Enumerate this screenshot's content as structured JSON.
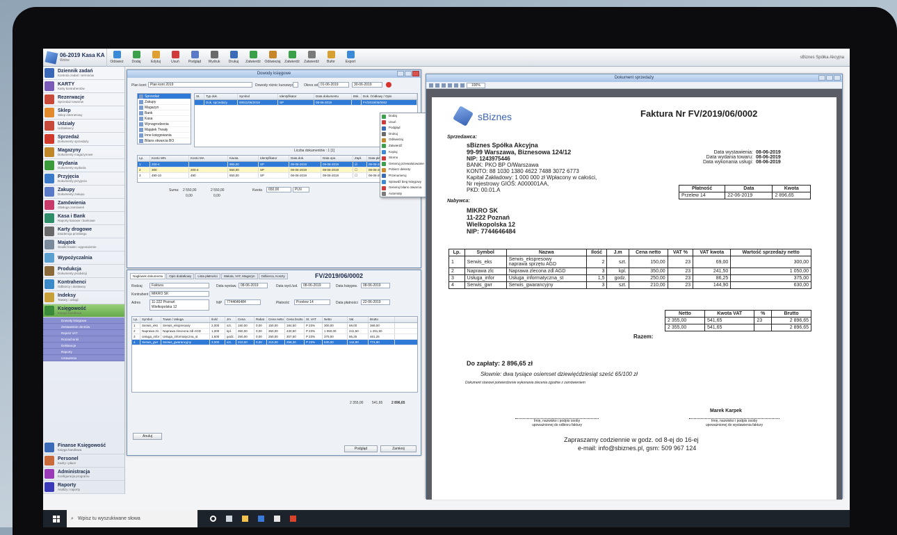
{
  "app": {
    "period": "06-2019 Kasa KA",
    "period_sub": "Wolne",
    "company": "sBiznes Spółka Akcyjna"
  },
  "toolbar": [
    "Odśwież",
    "Dodaj",
    "Edytuj",
    "Usuń",
    "Podgląd",
    "Wydruk",
    "Drukuj",
    "Zatwierdź",
    "Odświeżaj",
    "Zatwierdź",
    "Zatwierdź",
    "Bufor",
    "Export"
  ],
  "sidebar": [
    {
      "title": "Dziennik zadań",
      "sub": "Kontrola zadań i terminów",
      "color": "#3b67b8"
    },
    {
      "title": "KARTY",
      "sub": "Karty kontrahentów",
      "color": "#7a5bb8"
    },
    {
      "title": "Rezerwacje",
      "sub": "Sprzedaż towarów",
      "color": "#c84a3a"
    },
    {
      "title": "Sklep",
      "sub": "Sklep internetowy",
      "color": "#e08a2c"
    },
    {
      "title": "Udziały",
      "sub": "Udziałowcy",
      "color": "#c84a3a"
    },
    {
      "title": "Sprzedaż",
      "sub": "Dokumenty sprzedaży",
      "color": "#d0392e"
    },
    {
      "title": "Magazyny",
      "sub": "Dokumenty magazynowe",
      "color": "#c0862a"
    },
    {
      "title": "Wydania",
      "sub": "Dokumenty wydania",
      "color": "#3b9a3a"
    },
    {
      "title": "Przyjęcia",
      "sub": "Dokumenty przyjęcia",
      "color": "#3b7ac8"
    },
    {
      "title": "Zakupy",
      "sub": "Dokumenty zakupu",
      "color": "#5a7ac8"
    },
    {
      "title": "Zamówienia",
      "sub": "Obsługa zamówień",
      "color": "#c83a6a"
    },
    {
      "title": "Kasa i Bank",
      "sub": "Raporty kasowe i bankowe",
      "color": "#2e8e6a"
    },
    {
      "title": "Karty drogowe",
      "sub": "Ewidencja przebiegu",
      "color": "#6a6a6a"
    },
    {
      "title": "Majątek",
      "sub": "Środki trwałe i wyposażenie",
      "color": "#7a8a9a"
    },
    {
      "title": "Wypożyczalnia",
      "sub": "",
      "color": "#5aa0d0"
    },
    {
      "title": "Produkcja",
      "sub": "Dokumenty produkcji",
      "color": "#8a6a3a"
    },
    {
      "title": "Kontrahenci",
      "sub": "Odbiorcy i dostawcy",
      "color": "#3a8ac8"
    },
    {
      "title": "Indeksy",
      "sub": "Towary i usługi",
      "color": "#c8a03a"
    },
    {
      "title": "Księgowość",
      "sub": "Księga handlowa",
      "color": "#3a8a3a"
    }
  ],
  "sidebar_sub": [
    "Dowody księgowe",
    "Zestawienie obrotów",
    "Rejestr VAT",
    "Rozrachunki",
    "Deklaracje",
    "Raporty",
    "Ustawienia"
  ],
  "sidebar_bottom": [
    {
      "title": "Finanse Księgowość",
      "sub": "Księga handlowa",
      "color": "#3a6ab8"
    },
    {
      "title": "Personel",
      "sub": "Kadry i płace",
      "color": "#c86a3a"
    },
    {
      "title": "Administracja",
      "sub": "Konfiguracja programu",
      "color": "#9a3ab8"
    },
    {
      "title": "Raporty",
      "sub": "Analizy i raporty",
      "color": "#3a3ab8"
    }
  ],
  "ledger": {
    "title": "Dowody księgowe",
    "plan_label": "Plan kont:",
    "plan_value": "Plan kont 2019",
    "okres_label": "Okres od",
    "date_from": "01-06-2019",
    "date_to": "30-06-2019",
    "diff_label": "Dowody różnic kursowych",
    "tree": [
      "Sprzedaż",
      "Zakupy",
      "Magazyn",
      "Bank",
      "Kasa",
      "Wynagrodzenia",
      "Majątek Trwały",
      "Inne księgowania",
      "Bilans otwarcia BO"
    ],
    "grid_headers": [
      "St.",
      "Typ dok.",
      "Symbol",
      "Identyfikator",
      "Data dokumentu",
      "Bsk.",
      "Dok. źródłowy / Opis"
    ],
    "grid_rows": [
      [
        "",
        "Dok. sprzedaży",
        "00011/06/2019",
        "SP",
        "08-06-2019",
        "",
        "FV/2019/06/0002"
      ]
    ],
    "doc_count": "Liczba dokumentów : 1 [1]",
    "lines_headers": [
      "Lp.",
      "Konto WN",
      "Konto MA",
      "Kwota",
      "Identyfikator",
      "Data dok.",
      "Data ope.",
      "Zapł.",
      "Data płat."
    ],
    "lines": [
      [
        "1",
        "200-4",
        "",
        "950,00",
        "SP",
        "08-06-2019",
        "08-06-2019",
        "☑",
        "08-06-2019"
      ],
      [
        "2",
        "300",
        "200-4",
        "650,00",
        "SP",
        "08-06-2019",
        "08-06-2019",
        "☐",
        "08-06-2019"
      ],
      [
        "3",
        "490-10",
        "490",
        "650,00",
        "SP",
        "08-06-2019",
        "08-06-2019",
        "☐",
        "08-06-2019"
      ]
    ],
    "suma_label": "Suma:",
    "suma_wn": "2 550,00",
    "suma_ma": "2 550,00",
    "zero": "0,00",
    "kwota_label": "Kwota",
    "kwota_value": "650,00",
    "waluta": "PLN"
  },
  "context_menu": [
    "Dodaj",
    "Usuń",
    "Podgląd",
    "Drukuj",
    "Odświeżaj",
    "Zatwierdź",
    "Kopiuj",
    "Storno",
    "Generuj przewalutowanie",
    "Pobierz dekrety",
    "Przenumeruj",
    "Sprawdź bieg księgowy",
    "Generuj bilans otwarcia",
    "Automaty"
  ],
  "sale": {
    "tabs": [
      "Nagłówek dokumentu",
      "Opis dodatkowy",
      "Lista płatności",
      "Waluta, VAT, Magazyn",
      "Odbiorca, Koszty"
    ],
    "number": "FV/2019/06/0002",
    "rodzaj": "Faktura",
    "kontrahent": "MIKRO SK",
    "adres": "11-222 Poznań\nWielkopolska 12",
    "nip": "7744646484",
    "data_wyst": "08-06-2019",
    "data_sprz": "08-06-2019",
    "data_ksieg": "08-06-2019",
    "platnosc": "Przelew 14",
    "termin": "22-06-2019",
    "item_headers": [
      "Lp.",
      "Symbol",
      "Towar / Usługa",
      "Ilość",
      "Jm",
      "Cena",
      "Rabat",
      "Cena netto",
      "Cena brutto",
      "St. VAT",
      "Netto",
      "Vat",
      "Brutto"
    ],
    "items": [
      [
        "1",
        "Serwis_eks",
        "Serwis_ekspresowy",
        "2,000",
        "szt.",
        "150,00",
        "0,00",
        "150,00",
        "184,50",
        "P 23%",
        "300,00",
        "69,00",
        "369,00"
      ],
      [
        "2",
        "Naprawa zlc",
        "Naprawa zleceona zdl AGD",
        "1,000",
        "kpl.",
        "350,00",
        "0,00",
        "350,00",
        "430,50",
        "P 23%",
        "1 050,00",
        "241,50",
        "1 291,50"
      ],
      [
        "3",
        "Usługa_infor",
        "Usługa_informatyczna_st",
        "1,500",
        "godz.",
        "250,00",
        "0,00",
        "250,00",
        "307,50",
        "P 23%",
        "375,00",
        "86,25",
        "461,25"
      ],
      [
        "4",
        "Serwis_gwr",
        "Serwis_gwarancyjny",
        "3,000",
        "szt.",
        "210,00",
        "0,00",
        "210,00",
        "258,30",
        "P 23%",
        "630,00",
        "144,90",
        "774,90"
      ]
    ],
    "sum_netto": "2 355,00",
    "sum_vat": "541,65",
    "sum_brutto": "2 896,65",
    "btn_anuluj": "Anuluj",
    "btn_podglad": "Podgląd",
    "btn_zapisz": "Zamknij"
  },
  "document": {
    "title": "Dokument sprzedaży",
    "zoom": "100%",
    "logo_text": "sBiznes",
    "invoice_title": "Faktura Nr FV/2019/06/0002",
    "seller_label": "Sprzedawca:",
    "seller": [
      "sBiznes Spółka Akcyjna",
      "99-99 Warszawa, Biznesowa 124/12",
      "NIP: 1243975446",
      "BANK: PKO BP O/Warszawa",
      "KONTO: 88 1030 1380 4622 7488 3072 6773",
      "Kapitał Zakładowy: 1 000 000 zł  Wpłacony w całości,",
      "Nr rejestrowy GIOŚ: A000001AA,",
      "PKD: 00.01.A"
    ],
    "dates": [
      {
        "label": "Data wystawienia:",
        "value": "08-06-2019"
      },
      {
        "label": "Data wydania towaru:",
        "value": "08-06-2019"
      },
      {
        "label": "Data wykonania usługi:",
        "value": "08-06-2019"
      }
    ],
    "pay_headers": [
      "Płatność",
      "Data",
      "Kwota"
    ],
    "pay_row": [
      "Przelew 14",
      "22-06-2019",
      "2 896,65"
    ],
    "buyer_label": "Nabywca:",
    "buyer": [
      "MIKRO SK",
      "11-222 Poznań",
      "Wielkopolska 12",
      "NIP: 7744646484"
    ],
    "table_headers": [
      "Lp.",
      "Symbol",
      "Nazwa",
      "Ilość",
      "J.m",
      "Cena netto",
      "VAT %",
      "VAT kwota",
      "Wartość sprzedaży netto"
    ],
    "rows": [
      [
        "1",
        "Serwis_eks",
        "Serwis_ekspresowy\nnaprawa sprzętu AGD",
        "2",
        "szt.",
        "150,00",
        "23",
        "69,00",
        "300,00"
      ],
      [
        "2",
        "Naprawa zlc",
        "Naprawa zlecona zdl AGD",
        "3",
        "kpl.",
        "350,00",
        "23",
        "241,50",
        "1 050,00"
      ],
      [
        "3",
        "Usługa_infor",
        "Usługa_informatyczna_st",
        "1,5",
        "godz.",
        "250,00",
        "23",
        "86,25",
        "375,00"
      ],
      [
        "4",
        "Serwis_gwr",
        "Serwis_gwarancyjny",
        "3",
        "szt.",
        "210,00",
        "23",
        "144,90",
        "630,00"
      ]
    ],
    "sum_headers": [
      "Netto",
      "Kwota VAT",
      "%",
      "Brutto"
    ],
    "sum_row": [
      "2 355,00",
      "541,65",
      "23",
      "2 896,65"
    ],
    "razem_label": "Razem:",
    "razem_row": [
      "2 355,00",
      "541,65",
      "",
      "2 896,65"
    ],
    "do_zaplaty": "Do zapłaty: 2 896,65 zł",
    "slownie": "Słownie:  dwa tysiące osiemset dziewięćdziesiąt sześć 65/100 zł",
    "note": "Dokument stanowi potwierdzenie wykonania zlecenia zgodnie z zamówieniem",
    "sig_left": "Imię, nazwisko i podpis osoby\nupoważnionej do odbioru faktury",
    "signer": "Marek Karpek",
    "sig_right": "Imię, nazwisko i podpis osoby\nupoważnionej do wystawienia faktury",
    "footer1": "Zapraszamy codziennie w godz. od 8-ej do 16-ej",
    "footer2": "e-mail: info@sbiznes.pl, gsm: 509 967 124"
  },
  "taskbar": {
    "search_placeholder": "Wpisz tu wyszukiwane słowa"
  }
}
